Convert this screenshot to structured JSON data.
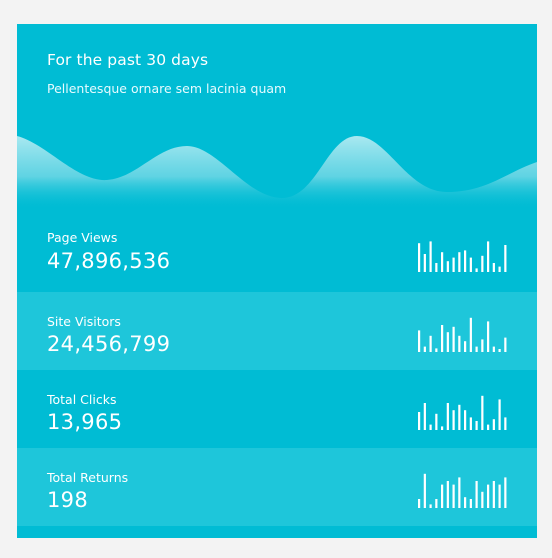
{
  "header": {
    "title": "For the past 30 days",
    "subtitle": "Pellentesque ornare sem lacinia quam"
  },
  "colors": {
    "card_background": "#00bcd4",
    "row_alternate": "#1ec6da",
    "wave_light": "#b2ebf2",
    "bar": "#ffffff"
  },
  "stats": [
    {
      "label": "Page Views",
      "value": "47,896,536",
      "bars": [
        0.8,
        0.5,
        0.85,
        0.25,
        0.55,
        0.3,
        0.4,
        0.55,
        0.6,
        0.4,
        0.1,
        0.45,
        0.85,
        0.25,
        0.15,
        0.75
      ]
    },
    {
      "label": "Site Visitors",
      "value": "24,456,799",
      "bars": [
        0.6,
        0.15,
        0.45,
        0.1,
        0.75,
        0.55,
        0.7,
        0.45,
        0.3,
        0.95,
        0.15,
        0.35,
        0.85,
        0.15,
        0.05,
        0.4
      ]
    },
    {
      "label": "Total Clicks",
      "value": "13,965",
      "bars": [
        0.5,
        0.75,
        0.15,
        0.45,
        0.1,
        0.75,
        0.55,
        0.7,
        0.55,
        0.35,
        0.25,
        0.95,
        0.15,
        0.3,
        0.85,
        0.35
      ]
    },
    {
      "label": "Total Returns",
      "value": "198",
      "bars": [
        0.25,
        0.95,
        0.1,
        0.25,
        0.65,
        0.75,
        0.65,
        0.85,
        0.3,
        0.25,
        0.75,
        0.45,
        0.65,
        0.75,
        0.65,
        0.85
      ]
    }
  ]
}
